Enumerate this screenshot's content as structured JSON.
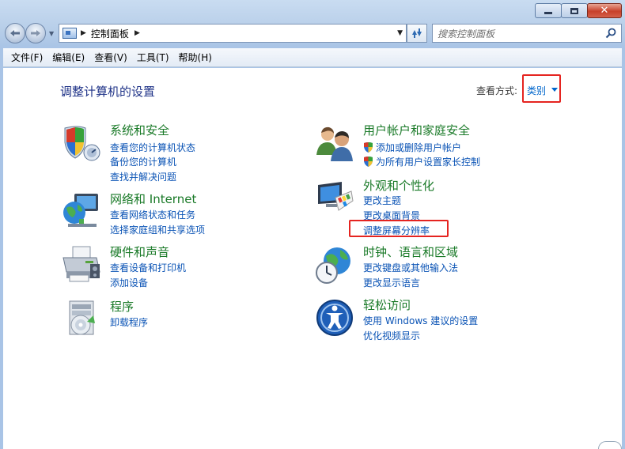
{
  "window": {
    "controls": {
      "minimize": "",
      "maximize": "",
      "close": "✕"
    }
  },
  "navbar": {
    "breadcrumb": "控制面板",
    "search_placeholder": "搜索控制面板"
  },
  "menu": [
    "文件(F)",
    "编辑(E)",
    "查看(V)",
    "工具(T)",
    "帮助(H)"
  ],
  "content": {
    "title": "调整计算机的设置",
    "view_by_label": "查看方式:",
    "view_by_value": "类别"
  },
  "categories": [
    {
      "title": "系统和安全",
      "icon": "security-shield-icon",
      "links": [
        "查看您的计算机状态",
        "备份您的计算机",
        "查找并解决问题"
      ]
    },
    {
      "title": "网络和 Internet",
      "icon": "network-globe-icon",
      "links": [
        "查看网络状态和任务",
        "选择家庭组和共享选项"
      ]
    },
    {
      "title": "硬件和声音",
      "icon": "printer-icon",
      "links": [
        "查看设备和打印机",
        "添加设备"
      ]
    },
    {
      "title": "程序",
      "icon": "programs-disc-icon",
      "links": [
        "卸载程序"
      ]
    },
    {
      "title": "用户帐户和家庭安全",
      "icon": "users-icon",
      "links": [
        "添加或删除用户帐户",
        "为所有用户设置家长控制"
      ]
    },
    {
      "title": "外观和个性化",
      "icon": "monitor-palette-icon",
      "links": [
        "更改主题",
        "更改桌面背景",
        "调整屏幕分辨率"
      ]
    },
    {
      "title": "时钟、语言和区域",
      "icon": "clock-globe-icon",
      "links": [
        "更改键盘或其他输入法",
        "更改显示语言"
      ]
    },
    {
      "title": "轻松访问",
      "icon": "ease-of-access-icon",
      "links": [
        "使用 Windows 建议的设置",
        "优化视频显示"
      ]
    }
  ],
  "colors": {
    "title_blue": "#1e3287",
    "category_green": "#1a7a28",
    "link_blue": "#0a53b5",
    "highlight_red": "#e52420"
  }
}
